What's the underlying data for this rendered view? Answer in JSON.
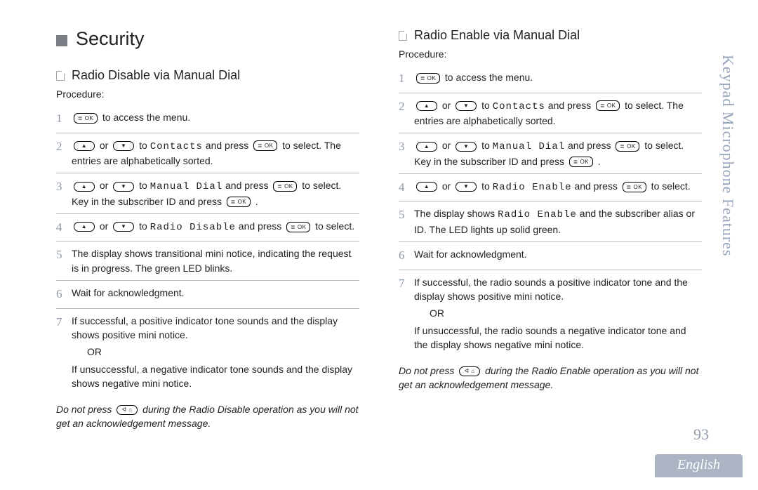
{
  "side_tab": "Keypad Microphone Features",
  "page_number": "93",
  "language": "English",
  "keys": {
    "ok": "≣ OK",
    "up": "▲",
    "down": "▼",
    "back": "ᐊ ⌂"
  },
  "left": {
    "section_title": "Security",
    "sub_title": "Radio Disable via Manual Dial",
    "proc_label": "Procedure:",
    "steps": {
      "s1_tail": " to access the menu.",
      "s2_p1": " or ",
      "s2_p2": " to ",
      "s2_contacts": "Contacts",
      "s2_p3": " and press ",
      "s2_p4": " to select. The entries are alphabetically sorted.",
      "s3_p1": " or ",
      "s3_p2": " to ",
      "s3_manual": "Manual Dial",
      "s3_p3": " and press ",
      "s3_p4": " to select.",
      "s3_line2a": "Key in the subscriber ID and press ",
      "s3_line2b": " .",
      "s4_p1": " or ",
      "s4_p2": " to ",
      "s4_rd": "Radio Disable",
      "s4_p3": " and press ",
      "s4_p4": " to select.",
      "s5": "The display shows transitional mini notice, indicating the request is in progress. The green LED blinks.",
      "s6": "Wait for acknowledgment.",
      "s7a": "If successful, a positive indicator tone sounds and the display shows positive mini notice.",
      "or": "OR",
      "s7b": "If unsuccessful, a negative indicator tone sounds and the display shows negative mini notice."
    },
    "note_p1": "Do not press ",
    "note_p2": " during the Radio  Disable operation as you will not get an acknowledgement message."
  },
  "right": {
    "sub_title": "Radio Enable via Manual Dial",
    "proc_label": "Procedure:",
    "steps": {
      "s1_tail": " to access the menu.",
      "s2_p1": " or ",
      "s2_p2": " to ",
      "s2_contacts": "Contacts",
      "s2_p3": " and press ",
      "s2_p4": " to select. The entries are alphabetically sorted.",
      "s3_p1": " or ",
      "s3_p2": " to ",
      "s3_manual": "Manual Dial",
      "s3_p3": " and press ",
      "s3_p4": " to select.",
      "s3_line2a": "Key in the subscriber ID and press ",
      "s3_line2b": " .",
      "s4_p1": " or ",
      "s4_p2": " to ",
      "s4_re": "Radio Enable",
      "s4_p3": " and press ",
      "s4_p4": " to select.",
      "s5a": "The display shows ",
      "s5_re": "Radio Enable",
      "s5b": " and the subscriber alias or ID. The LED lights up solid green.",
      "s6": "Wait for acknowledgment.",
      "s7a": "If successful, the radio sounds a positive indicator tone and the display shows positive mini notice.",
      "or": "OR",
      "s7b": "If unsuccessful, the radio sounds a negative indicator tone and the display shows negative mini notice."
    },
    "note_p1": "Do not press ",
    "note_p2": " during the Radio Enable operation as you will not get an acknowledgement message."
  }
}
